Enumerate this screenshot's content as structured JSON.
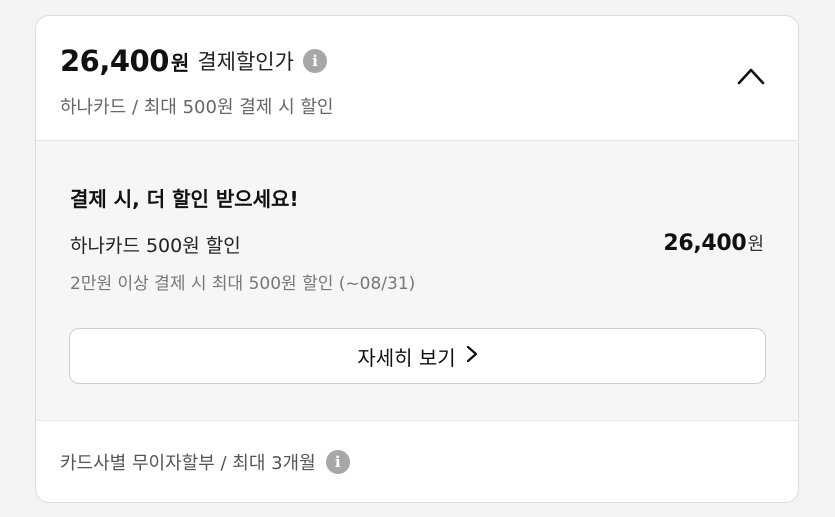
{
  "header": {
    "price_amount": "26,400",
    "price_unit": "원",
    "price_label": "결제할인가",
    "info_glyph": "i",
    "subtitle": "하나카드 / 최대 500원 결제 시 할인",
    "collapse_icon": "chevron-up-icon"
  },
  "benefit": {
    "title": "결제 시, 더 할인 받으세요!",
    "offer_name": "하나카드 500원 할인",
    "offer_amount": "26,400",
    "offer_unit": "원",
    "offer_detail": "2만원 이상 결제 시 최대 500원 할인 (~08/31)",
    "detail_button_label": "자세히 보기"
  },
  "installment": {
    "text": "카드사별 무이자할부 / 최대 3개월",
    "info_glyph": "i"
  },
  "colors": {
    "card_bg": "#ffffff",
    "panel_bg": "#f6f6f6",
    "page_bg": "#f4f4f4",
    "info_icon": "#a7a7a7"
  }
}
